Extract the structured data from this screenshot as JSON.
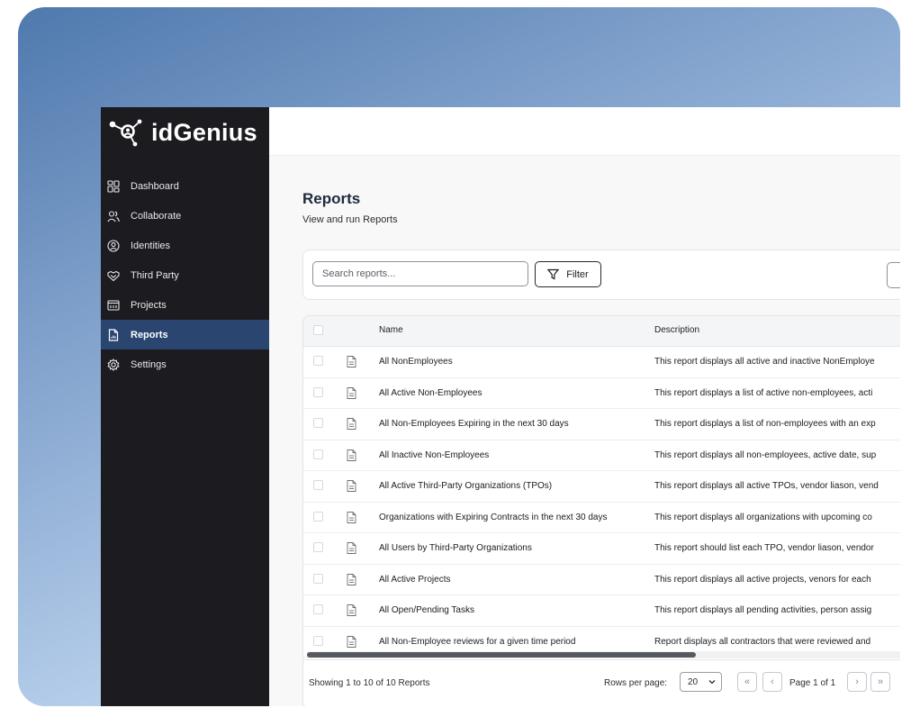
{
  "app": {
    "logo_text": "idGenius"
  },
  "sidebar": {
    "items": [
      {
        "label": "Dashboard",
        "icon": "dashboard-icon"
      },
      {
        "label": "Collaborate",
        "icon": "users-icon"
      },
      {
        "label": "Identities",
        "icon": "identity-icon"
      },
      {
        "label": "Third Party",
        "icon": "handshake-icon"
      },
      {
        "label": "Projects",
        "icon": "projects-icon"
      },
      {
        "label": "Reports",
        "icon": "report-icon",
        "active": true
      },
      {
        "label": "Settings",
        "icon": "gear-icon"
      }
    ]
  },
  "page": {
    "title": "Reports",
    "subtitle": "View and run Reports"
  },
  "toolbar": {
    "search_placeholder": "Search reports...",
    "filter_label": "Filter"
  },
  "table": {
    "columns": {
      "name": "Name",
      "description": "Description"
    },
    "rows": [
      {
        "name": "All NonEmployees",
        "description": "This report displays all active and inactive NonEmploye"
      },
      {
        "name": "All Active Non-Employees",
        "description": "This report displays a list of active non-employees, acti"
      },
      {
        "name": "All Non-Employees Expiring in the next 30 days",
        "description": "This report displays a list of non-employees with an exp"
      },
      {
        "name": "All Inactive Non-Employees",
        "description": "This report displays all non-employees, active date, sup"
      },
      {
        "name": "All Active Third-Party Organizations (TPOs)",
        "description": "This report displays all active TPOs, vendor liason, vend"
      },
      {
        "name": "Organizations with Expiring Contracts in the next 30 days",
        "description": "This report displays all organizations with upcoming co"
      },
      {
        "name": "All Users by Third-Party Organizations",
        "description": "This report should list each TPO, vendor liason, vendor"
      },
      {
        "name": "All Active Projects",
        "description": "This report displays all active projects, venors for each"
      },
      {
        "name": "All Open/Pending Tasks",
        "description": "This report displays all pending activities, person assig"
      },
      {
        "name": "All Non-Employee reviews for a given time period",
        "description": "Report displays all contractors that were reviewed and"
      }
    ]
  },
  "footer": {
    "showing": "Showing 1 to 10 of 10 Reports",
    "rows_per_page_label": "Rows per page:",
    "rows_per_page_value": "20",
    "page_text": "Page 1 of 1",
    "first_label": "«",
    "prev_label": "‹",
    "next_label": "›",
    "last_label": "»"
  }
}
